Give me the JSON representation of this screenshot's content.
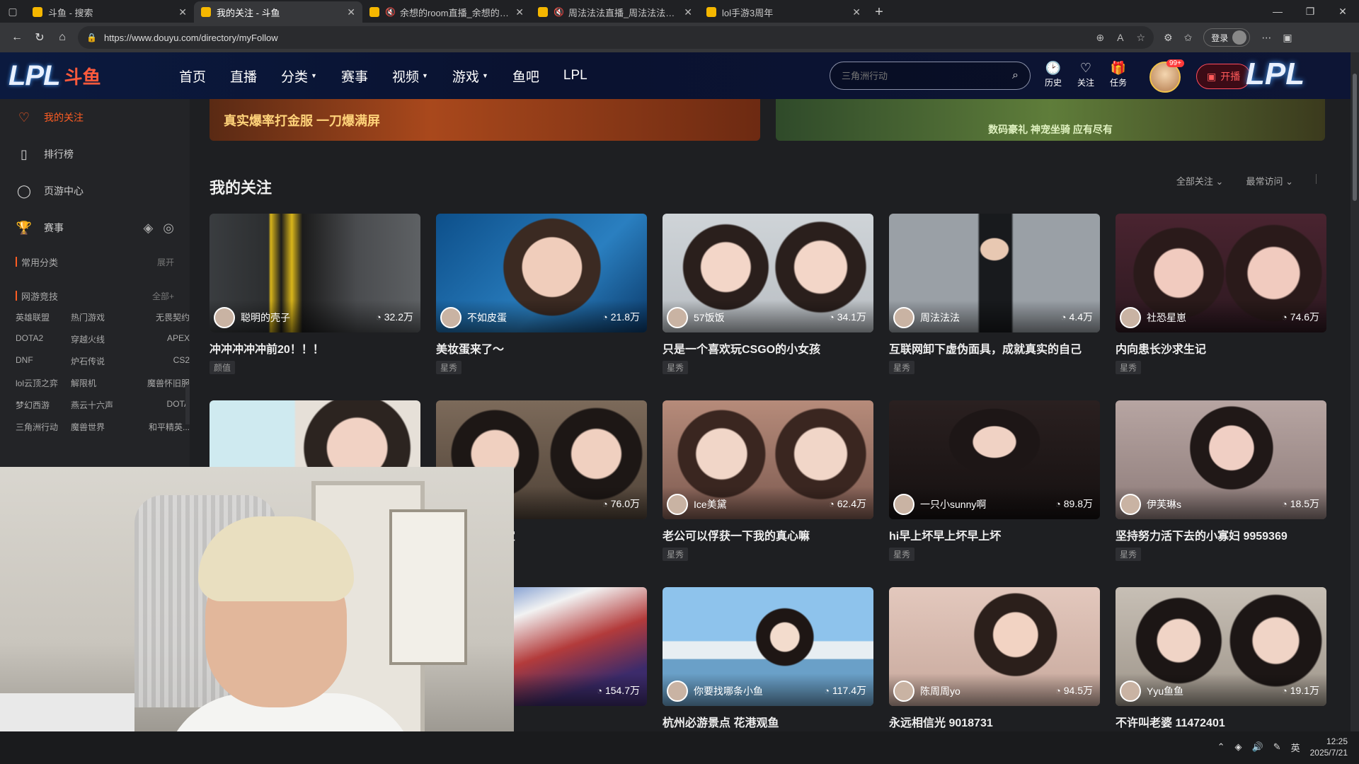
{
  "browser": {
    "tabs": [
      {
        "title": "斗鱼 - 搜索",
        "active": false,
        "muted": false
      },
      {
        "title": "我的关注 - 斗鱼",
        "active": true,
        "muted": false
      },
      {
        "title": "余想的room直播_余想的room",
        "active": false,
        "muted": true
      },
      {
        "title": "周法法法直播_周法法法直播",
        "active": false,
        "muted": true
      },
      {
        "title": "lol手游3周年",
        "active": false,
        "muted": false
      }
    ],
    "url": "https://www.douyu.com/directory/myFollow",
    "login_label": "登录"
  },
  "header": {
    "logo_lpl": "LPL",
    "logo_douyu": "斗鱼",
    "nav": [
      {
        "label": "首页",
        "dropdown": false
      },
      {
        "label": "直播",
        "dropdown": false
      },
      {
        "label": "分类",
        "dropdown": true
      },
      {
        "label": "赛事",
        "dropdown": false
      },
      {
        "label": "视频",
        "dropdown": true
      },
      {
        "label": "游戏",
        "dropdown": true
      },
      {
        "label": "鱼吧",
        "dropdown": false
      },
      {
        "label": "LPL",
        "dropdown": false
      }
    ],
    "search_placeholder": "三角洲行动",
    "actions": [
      {
        "label": "历史",
        "icon": "clock-icon"
      },
      {
        "label": "关注",
        "icon": "heart-icon"
      },
      {
        "label": "任务",
        "icon": "gift-icon"
      }
    ],
    "notification_badge": "99+",
    "go_live_label": "开播",
    "brand_right": "LPL"
  },
  "sidebar": {
    "items": [
      {
        "label": "我的关注",
        "icon": "heart-icon",
        "active": true
      },
      {
        "label": "排行榜",
        "icon": "ranking-icon",
        "active": false
      },
      {
        "label": "页游中心",
        "icon": "mouse-icon",
        "active": false
      },
      {
        "label": "赛事",
        "icon": "trophy-icon",
        "active": false
      }
    ],
    "frequent": {
      "title": "常用分类",
      "more": "展开"
    },
    "online_games": {
      "title": "网游竞技",
      "more": "全部+",
      "categories": [
        "英雄联盟",
        "热门游戏",
        "无畏契约",
        "DOTA2",
        "穿越火线",
        "APEX",
        "DNF",
        "炉石传说",
        "CS2",
        "lol云顶之弈",
        "解限机",
        "魔兽怀旧服",
        "梦幻西游",
        "燕云十六声",
        "DOTA",
        "三角洲行动",
        "魔兽世界",
        "和平精英..."
      ]
    }
  },
  "main": {
    "banner_left_text": "真实爆率打金服 一刀爆满屏",
    "banner_right_text": "数码豪礼 神宠坐骑 应有尽有",
    "title": "我的关注",
    "filters": [
      "全部关注",
      "最常访问"
    ],
    "cards": [
      {
        "streamer": "聪明的壳子",
        "viewers": "32.2万",
        "title": "冲冲冲冲冲前20！！！",
        "tag": "颜值"
      },
      {
        "streamer": "不如皮蛋",
        "viewers": "21.8万",
        "title": "美妆蛋来了～",
        "tag": "星秀"
      },
      {
        "streamer": "57饭饭",
        "viewers": "34.1万",
        "title": "只是一个喜欢玩CSGO的小女孩",
        "tag": "星秀"
      },
      {
        "streamer": "周法法法",
        "viewers": "4.4万",
        "title": "互联网卸下虚伪面具，成就真实的自己",
        "tag": "星秀"
      },
      {
        "streamer": "社恐星崽",
        "viewers": "74.6万",
        "title": "内向患长沙求生记",
        "tag": "星秀"
      },
      {
        "streamer": "",
        "viewers": "",
        "title": "",
        "tag": ""
      },
      {
        "streamer": "",
        "viewers": "76.0万",
        "title": "能成为你的宝宝",
        "tag": ""
      },
      {
        "streamer": "Ice美黛",
        "viewers": "62.4万",
        "title": "老公可以俘获一下我的真心嘛",
        "tag": "星秀"
      },
      {
        "streamer": "一只小sunny啊",
        "viewers": "89.8万",
        "title": "hi早上坏早上坏早上坏",
        "tag": "星秀"
      },
      {
        "streamer": "伊芙琳s",
        "viewers": "18.5万",
        "title": "坚持努力活下去的小寡妇 9959369",
        "tag": "星秀"
      },
      {
        "streamer": "",
        "viewers": "",
        "title": "",
        "tag": ""
      },
      {
        "streamer": "赛事",
        "viewers": "154.7万",
        "title": "】7.23开赛",
        "tag": ""
      },
      {
        "streamer": "你要找哪条小鱼",
        "viewers": "117.4万",
        "title": "杭州必游景点 花港观鱼",
        "tag": ""
      },
      {
        "streamer": "陈周周yo",
        "viewers": "94.5万",
        "title": "永远相信光 9018731",
        "tag": ""
      },
      {
        "streamer": "Yyu鱼鱼",
        "viewers": "19.1万",
        "title": "不许叫老婆 11472401",
        "tag": ""
      }
    ]
  },
  "taskbar": {
    "time": "12:25",
    "date": "2025/7/21",
    "ime": "英"
  }
}
